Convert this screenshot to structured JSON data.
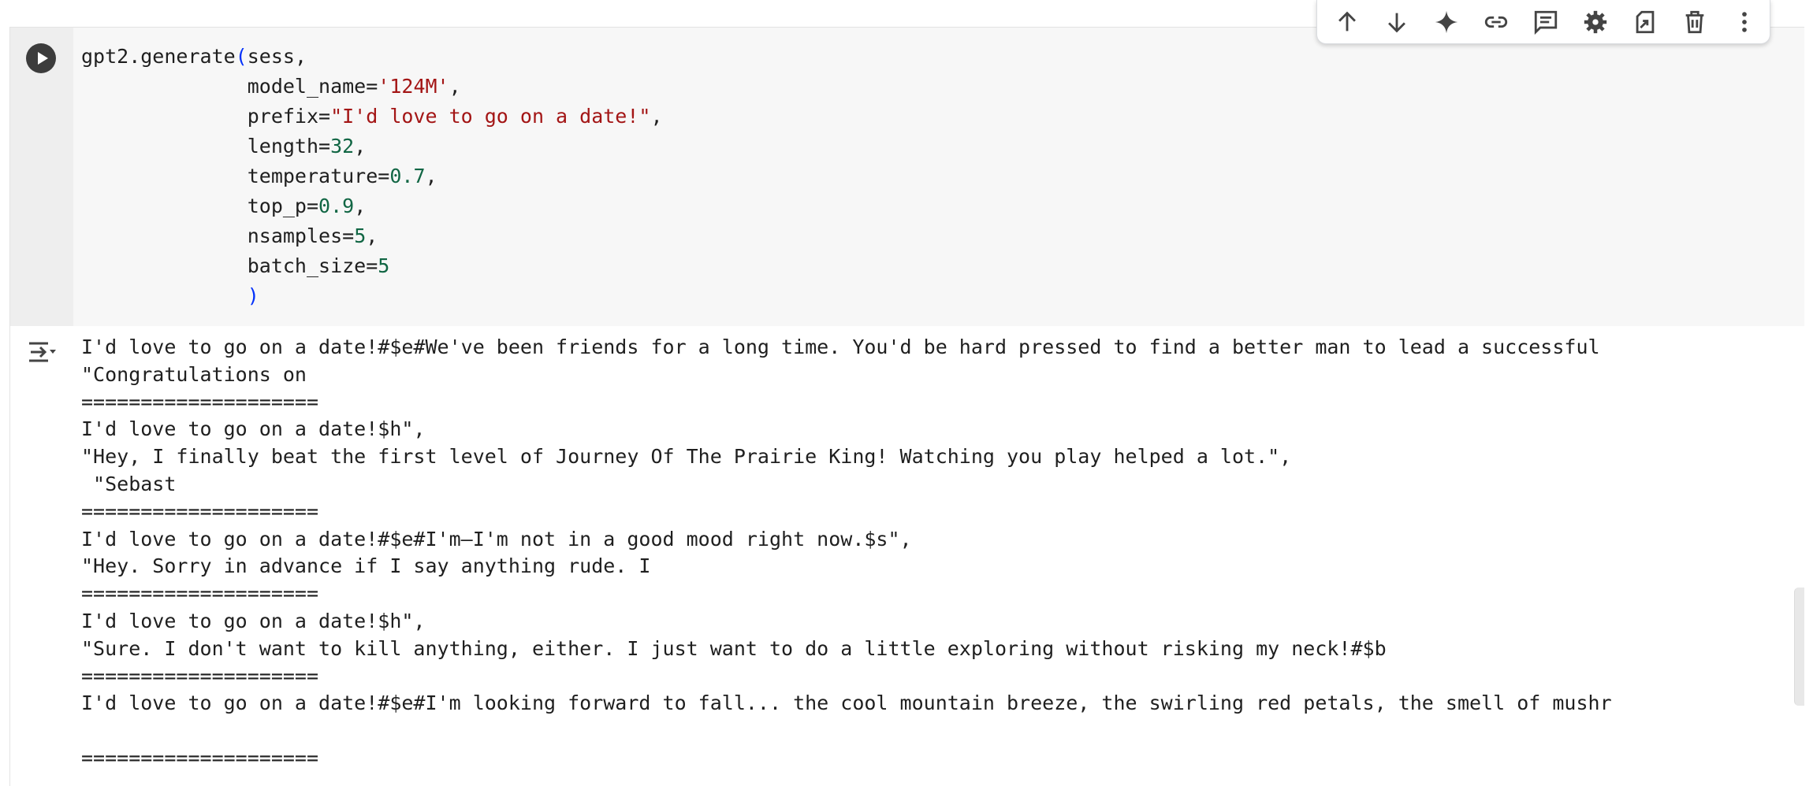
{
  "toolbar": {
    "buttons": [
      {
        "name": "move-up-icon",
        "title": "Move cell up"
      },
      {
        "name": "move-down-icon",
        "title": "Move cell down"
      },
      {
        "name": "sparkle-icon",
        "title": "Gemini"
      },
      {
        "name": "link-icon",
        "title": "Copy link to cell"
      },
      {
        "name": "comment-icon",
        "title": "Add comment"
      },
      {
        "name": "gear-icon",
        "title": "Open editor settings"
      },
      {
        "name": "mirror-cell-icon",
        "title": "Mirror cell in tab"
      },
      {
        "name": "trash-icon",
        "title": "Delete cell"
      },
      {
        "name": "more-vert-icon",
        "title": "More cell actions"
      }
    ]
  },
  "cell": {
    "code_lines": [
      [
        {
          "t": "plain",
          "v": "gpt2.generate"
        },
        {
          "t": "paren",
          "v": "("
        },
        {
          "t": "plain",
          "v": "sess,"
        }
      ],
      [
        {
          "t": "plain",
          "v": "              model_name="
        },
        {
          "t": "str",
          "v": "'124M'"
        },
        {
          "t": "plain",
          "v": ","
        }
      ],
      [
        {
          "t": "plain",
          "v": "              prefix="
        },
        {
          "t": "str",
          "v": "\"I'd love to go on a date!\""
        },
        {
          "t": "plain",
          "v": ","
        }
      ],
      [
        {
          "t": "plain",
          "v": "              length="
        },
        {
          "t": "num",
          "v": "32"
        },
        {
          "t": "plain",
          "v": ","
        }
      ],
      [
        {
          "t": "plain",
          "v": "              temperature="
        },
        {
          "t": "num",
          "v": "0.7"
        },
        {
          "t": "plain",
          "v": ","
        }
      ],
      [
        {
          "t": "plain",
          "v": "              top_p="
        },
        {
          "t": "num",
          "v": "0.9"
        },
        {
          "t": "plain",
          "v": ","
        }
      ],
      [
        {
          "t": "plain",
          "v": "              nsamples="
        },
        {
          "t": "num",
          "v": "5"
        },
        {
          "t": "plain",
          "v": ","
        }
      ],
      [
        {
          "t": "plain",
          "v": "              batch_size="
        },
        {
          "t": "num",
          "v": "5"
        }
      ],
      [
        {
          "t": "plain",
          "v": "              "
        },
        {
          "t": "paren",
          "v": ")"
        }
      ]
    ],
    "output_lines": [
      "I'd love to go on a date!#$e#We've been friends for a long time. You'd be hard pressed to find a better man to lead a successful",
      "\"Congratulations on",
      "====================",
      "I'd love to go on a date!$h\",",
      "\"Hey, I finally beat the first level of Journey Of The Prairie King! Watching you play helped a lot.\",",
      " \"Sebast",
      "====================",
      "I'd love to go on a date!#$e#I'm—I'm not in a good mood right now.$s\",",
      "\"Hey. Sorry in advance if I say anything rude. I",
      "====================",
      "I'd love to go on a date!$h\",",
      "\"Sure. I don't want to kill anything, either. I just want to do a little exploring without risking my neck!#$b",
      "====================",
      "I'd love to go on a date!#$e#I'm looking forward to fall... the cool mountain breeze, the swirling red petals, the smell of mushr",
      "",
      "===================="
    ]
  },
  "colors": {
    "string": "#a31515",
    "number": "#116644",
    "paren": "#0431fa",
    "text": "#1f1f1f",
    "code_bg": "#f7f7f7"
  }
}
